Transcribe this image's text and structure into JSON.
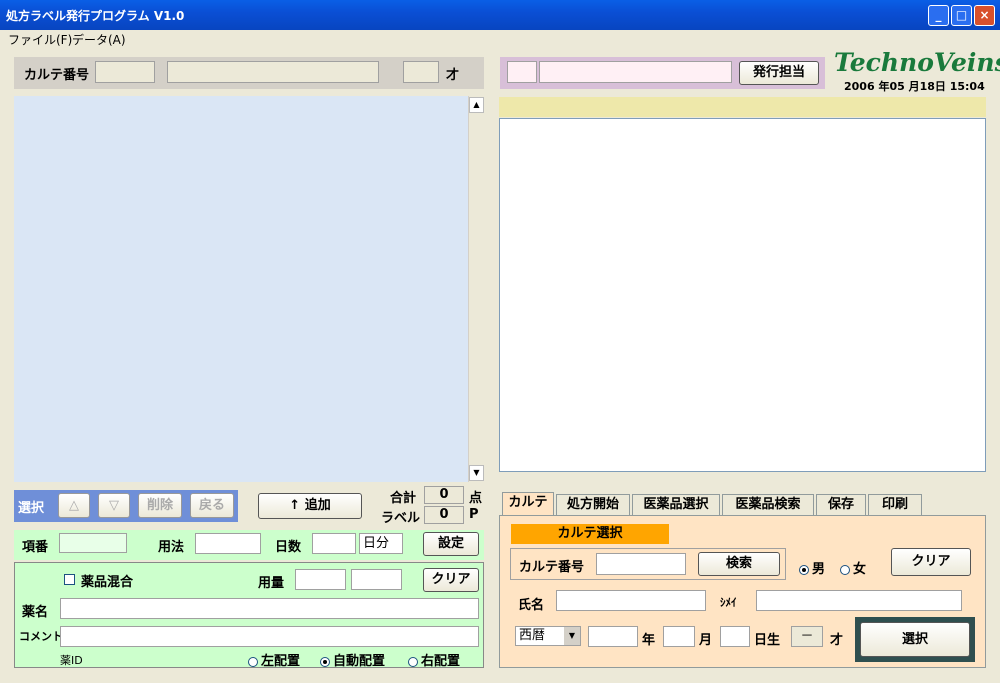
{
  "window": {
    "title": "処方ラベル発行プログラム V1.0"
  },
  "menu": [
    {
      "label": "ファイル(F)"
    },
    {
      "label": "データ(A)"
    }
  ],
  "header": {
    "karte_label": "カルテ番号",
    "age_unit": "才"
  },
  "issuer": {
    "button": "発行担当"
  },
  "brand": {
    "logo": "TechnoVeins",
    "datetime": "2006 年05 月18日 15:04"
  },
  "list_toolbar": {
    "select_label": "選択",
    "up": "△",
    "down": "▽",
    "delete": "削除",
    "back": "戻る",
    "add": "↑ 追加"
  },
  "totals": {
    "total_label": "合計",
    "total_value": "0",
    "total_unit": "点",
    "label_label": "ラベル",
    "label_value": "0",
    "label_unit": "P"
  },
  "item_form": {
    "index_label": "項番",
    "usage_label": "用法",
    "days_label": "日数",
    "days_unit": "日分",
    "set_button": "設定",
    "mix_label": "薬品混合",
    "dose_label": "用量",
    "clear_button": "クリア",
    "drug_label": "薬名",
    "comment_label": "コメント",
    "drug_id_label": "薬ID",
    "align": [
      {
        "label": "左配置",
        "selected": false
      },
      {
        "label": "自動配置",
        "selected": true
      },
      {
        "label": "右配置",
        "selected": false
      }
    ]
  },
  "tabs": [
    {
      "label": "カルテ",
      "active": true
    },
    {
      "label": "処方開始"
    },
    {
      "label": "医薬品選択"
    },
    {
      "label": "医薬品検索"
    },
    {
      "label": "保存"
    },
    {
      "label": "印刷"
    }
  ],
  "karte_panel": {
    "heading": "カルテ選択",
    "karte_label": "カルテ番号",
    "search_button": "検索",
    "male": "男",
    "female": "女",
    "clear_button": "クリア",
    "name_label": "氏名",
    "kana_label": "ｼﾒｲ",
    "era_value": "西暦",
    "year_label": "年",
    "month_label": "月",
    "birth_label": "日生",
    "age_value": "－",
    "age_unit": "才",
    "select_button": "選択"
  },
  "colors": {
    "list_bg": "#dae6f5",
    "form_bg": "#ccffcc",
    "karte_bg": "#ffe4c4",
    "orange": "#ffa500"
  }
}
